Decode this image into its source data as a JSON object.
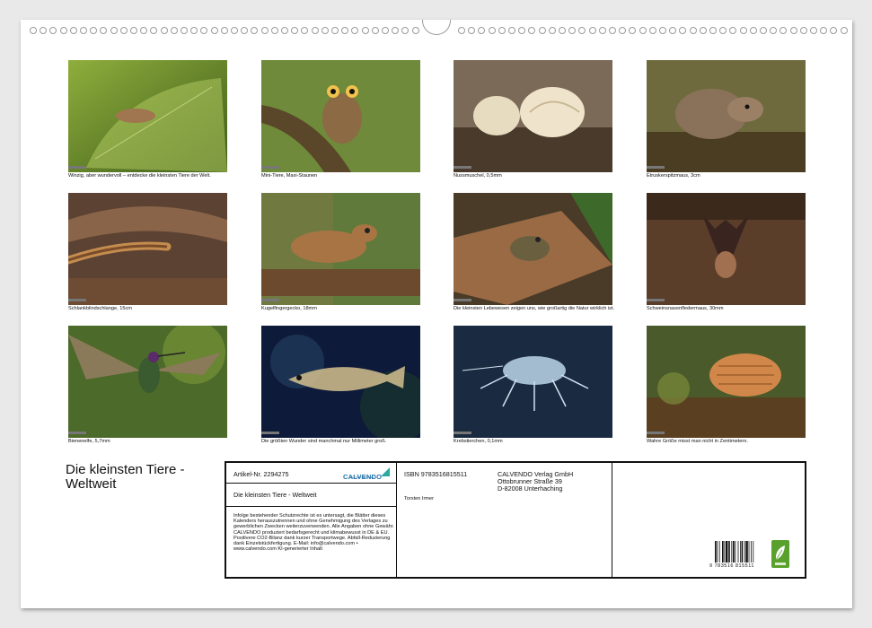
{
  "calendar": {
    "title": "Die kleinsten Tiere -\n Weltweit",
    "captions": [
      "Winzig, aber wundervoll – entdecke die kleinsten Tiere der Welt.",
      "Mini-Tiere, Maxi-Staunen",
      "Nussmuschel, 0,5mm",
      "Etruskerspitzmaus, 3cm",
      "Schlankblindschlange, 15cm",
      "Kugelfingergecko, 18mm",
      "Die kleinsten Lebewesen zeigen uns, wie großartig die Natur wirklich ist.",
      "Schweinsnasenfledermaus, 30mm",
      "Bienenelfe, 5,7mm",
      "Die größten Wunder sind manchmal nur Millimeter groß.",
      "Krebstierchen, 0,1mm",
      "Wahre Größe misst man nicht in Zentimetern."
    ]
  },
  "info": {
    "article_no": "Artikel-Nr. 2294275",
    "product_title": "Die kleinsten Tiere - Weltweit",
    "logo": "CALVENDO",
    "logo_sub": "Der Kalenderverlag",
    "legal": "Infolge bestehender Schutzrechte ist es untersagt, die Blätter dieses Kalenders herauszutrennen und ohne Genehmigung des Verlages zu gewerblichen Zwecken weiterzuverwenden. Alle Angaben ohne Gewähr. CALVENDO produziert bedarfsgerecht und klimabewusst in DE & EU. Positivere CO2-Bilanz dank kurzer Transportwege. Abfall-Reduzierung dank Einzelstückfertigung. E-Mail: info@calvendo.com • www.calvendo.com KI-generierter Inhalt",
    "isbn": "ISBN 9783516815511",
    "author": "Torsten Irmer",
    "publisher_line1": "CALVENDO Verlag GmbH",
    "publisher_line2": "Ottobrunner Straße 39",
    "publisher_line3": "D-82008 Unterhaching",
    "barcode_number": "9 783516 815511"
  },
  "colors": {
    "eco_badge": "#5aa02c",
    "logo_blue": "#1d6fa8"
  }
}
